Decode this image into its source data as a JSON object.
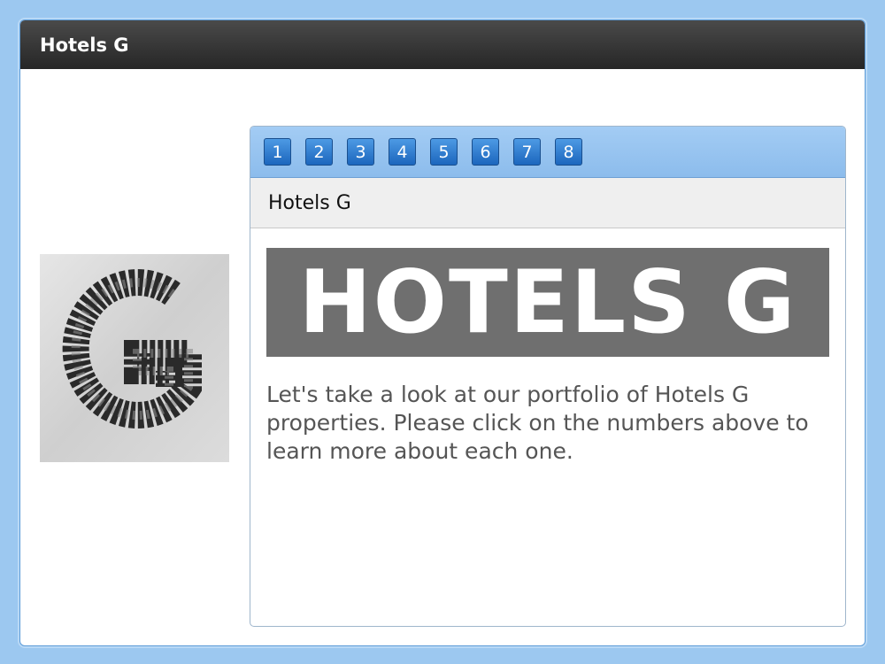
{
  "window": {
    "title": "Hotels G"
  },
  "logo": {
    "icon": "hotels-g-collage-logo",
    "letter": "G"
  },
  "tabs": [
    {
      "label": "1"
    },
    {
      "label": "2"
    },
    {
      "label": "3"
    },
    {
      "label": "4"
    },
    {
      "label": "5"
    },
    {
      "label": "6"
    },
    {
      "label": "7"
    },
    {
      "label": "8"
    }
  ],
  "panel": {
    "subtitle": "Hotels G",
    "banner_text": "HOTELS G",
    "description": "Let's take a look at our portfolio of Hotels G properties. Please click on the numbers above to learn more about each one."
  },
  "colors": {
    "titlebar": "#262626",
    "tabstrip": "#8cbcec",
    "button": "#1c66bd",
    "banner": "#6f6f6f",
    "background": "#9cc8f0"
  }
}
